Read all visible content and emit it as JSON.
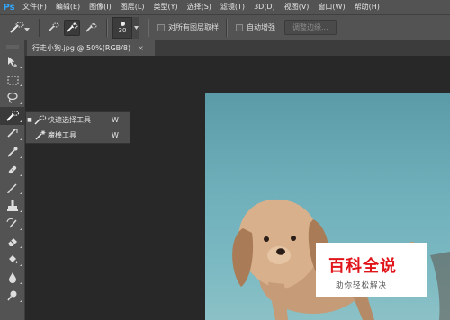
{
  "app": {
    "logo": "Ps"
  },
  "menu": [
    "文件(F)",
    "编辑(E)",
    "图像(I)",
    "图层(L)",
    "类型(Y)",
    "选择(S)",
    "滤镜(T)",
    "3D(D)",
    "视图(V)",
    "窗口(W)",
    "帮助(H)"
  ],
  "options": {
    "brush_size": "30",
    "sample_all_layers": "对所有图层取样",
    "auto_enhance": "自动增强",
    "refine_edge": "调整边缘..."
  },
  "document": {
    "tab_title": "行走小狗.jpg @ 50%(RGB/8)",
    "close": "×"
  },
  "flyout": {
    "items": [
      {
        "label": "快速选择工具",
        "shortcut": "W",
        "selected": true
      },
      {
        "label": "魔棒工具",
        "shortcut": "W",
        "selected": false
      }
    ]
  },
  "watermark": {
    "title": "百科全说",
    "subtitle": "助你轻松解决"
  },
  "colors": {
    "ps_blue": "#31a8ff",
    "panel": "#535353",
    "canvas_bg": "#282828",
    "watermark_red": "#e0161b"
  }
}
